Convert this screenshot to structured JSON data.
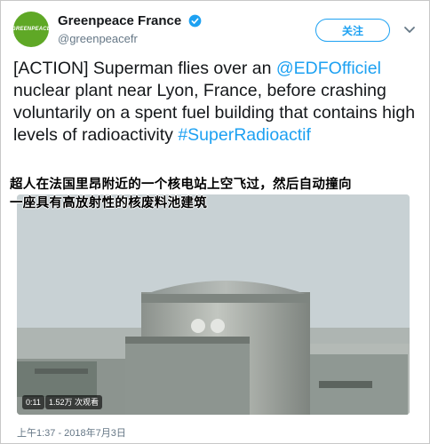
{
  "account": {
    "display_name": "Greenpeace France",
    "handle": "@greenpeacefr",
    "avatar_text": "GREENPEACE",
    "verified_icon": "verified-badge-icon",
    "brand_color": "#5fa826"
  },
  "follow_button": {
    "label": "关注",
    "color": "#1da1f2"
  },
  "tweet": {
    "part1": "[ACTION] Superman flies over an ",
    "mention": "@EDFOfficiel",
    "part2": " nuclear plant near Lyon, France, before crashing voluntarily on a spent fuel building that contains high levels of radioactivity ",
    "hashtag": "#SuperRadioactif"
  },
  "subtitles": {
    "line1": "超人在法国里昂附近的一个核电站上空飞过，然后自动撞向",
    "line2": "一座具有高放射性的核废料池建筑"
  },
  "video": {
    "duration": "0:11",
    "views": "1.52万 次观看"
  },
  "timestamp": "上午1:37 - 2018年7月3日"
}
